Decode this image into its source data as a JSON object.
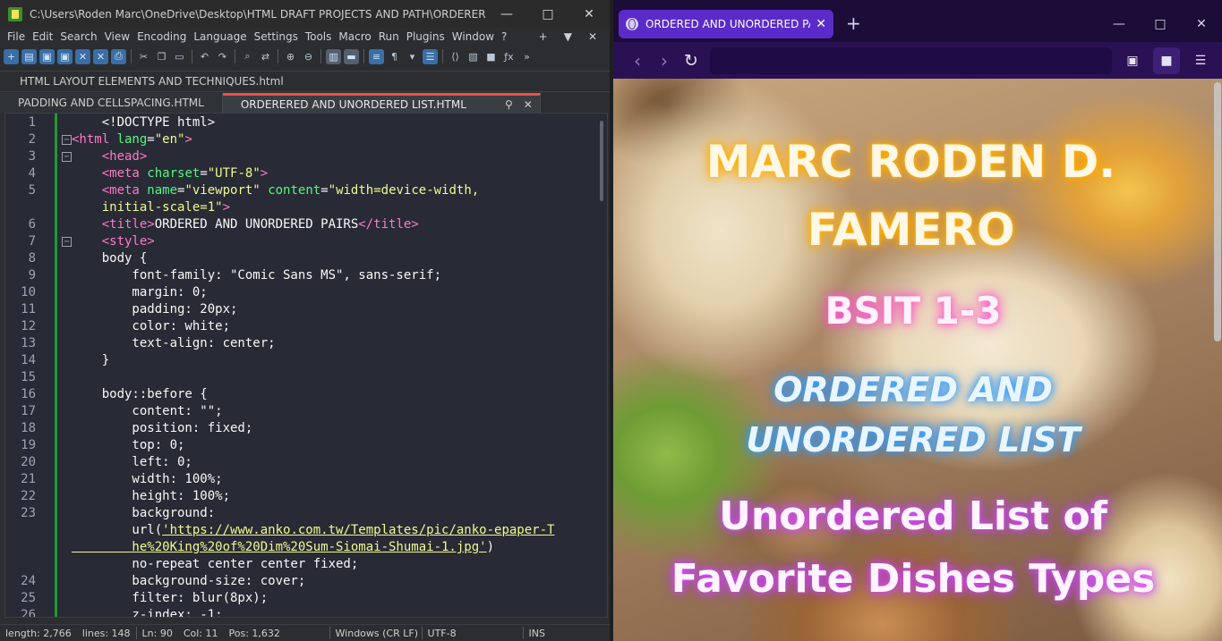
{
  "npp": {
    "title": "C:\\Users\\Roden Marc\\OneDrive\\Desktop\\HTML DRAFT PROJECTS AND PATH\\ORDERERED AND...",
    "menu": [
      "File",
      "Edit",
      "Search",
      "View",
      "Encoding",
      "Language",
      "Settings",
      "Tools",
      "Macro",
      "Run",
      "Plugins",
      "Window",
      "?"
    ],
    "menu_right": [
      "+",
      "▼",
      "✕"
    ],
    "project_tab": "HTML LAYOUT ELEMENTS  AND TECHNIQUES.html",
    "tabs": [
      {
        "label": "PADDING AND CELLSPACING.HTML"
      },
      {
        "label": "ORDERERED AND UNORDERED LIST.HTML"
      }
    ],
    "status": {
      "length": "length: 2,766",
      "lines": "lines: 148",
      "ln": "Ln: 90",
      "col": "Col: 11",
      "pos": "Pos: 1,632",
      "eol": "Windows (CR LF)",
      "encoding": "UTF-8",
      "mode": "INS"
    },
    "code": [
      {
        "n": "1",
        "fold": "",
        "segs": [
          {
            "c": "txt",
            "t": "    <!DOCTYPE html>"
          }
        ]
      },
      {
        "n": "2",
        "fold": "−",
        "segs": [
          {
            "c": "tag",
            "t": "<html "
          },
          {
            "c": "attr",
            "t": "lang"
          },
          {
            "c": "txt",
            "t": "="
          },
          {
            "c": "str",
            "t": "\"en\""
          },
          {
            "c": "tag",
            "t": ">"
          }
        ]
      },
      {
        "n": "3",
        "fold": "−",
        "segs": [
          {
            "c": "tag",
            "t": "    <head>"
          }
        ]
      },
      {
        "n": "4",
        "fold": "",
        "segs": [
          {
            "c": "tag",
            "t": "    <meta "
          },
          {
            "c": "attr",
            "t": "charset"
          },
          {
            "c": "txt",
            "t": "="
          },
          {
            "c": "str",
            "t": "\"UTF-8\""
          },
          {
            "c": "tag",
            "t": ">"
          }
        ]
      },
      {
        "n": "5",
        "fold": "",
        "segs": [
          {
            "c": "tag",
            "t": "    <meta "
          },
          {
            "c": "attr",
            "t": "name"
          },
          {
            "c": "txt",
            "t": "="
          },
          {
            "c": "str",
            "t": "\"viewport\""
          },
          {
            "c": "txt",
            "t": " "
          },
          {
            "c": "attr",
            "t": "content"
          },
          {
            "c": "txt",
            "t": "="
          },
          {
            "c": "str",
            "t": "\"width=device-width,"
          }
        ]
      },
      {
        "n": "",
        "fold": "",
        "segs": [
          {
            "c": "str",
            "t": "    initial-scale=1\""
          },
          {
            "c": "tag",
            "t": ">"
          }
        ]
      },
      {
        "n": "6",
        "fold": "",
        "segs": [
          {
            "c": "tag",
            "t": "    <title>"
          },
          {
            "c": "txt",
            "t": "ORDERED AND UNORDERED PAIRS"
          },
          {
            "c": "tag",
            "t": "</title>"
          }
        ]
      },
      {
        "n": "7",
        "fold": "−",
        "segs": [
          {
            "c": "tag",
            "t": "    <style>"
          }
        ]
      },
      {
        "n": "8",
        "fold": "",
        "segs": [
          {
            "c": "txt",
            "t": "    body {"
          }
        ]
      },
      {
        "n": "9",
        "fold": "",
        "segs": [
          {
            "c": "txt",
            "t": "        font-family: \"Comic Sans MS\", sans-serif;"
          }
        ]
      },
      {
        "n": "10",
        "fold": "",
        "segs": [
          {
            "c": "txt",
            "t": "        margin: 0;"
          }
        ]
      },
      {
        "n": "11",
        "fold": "",
        "segs": [
          {
            "c": "txt",
            "t": "        padding: 20px;"
          }
        ]
      },
      {
        "n": "12",
        "fold": "",
        "segs": [
          {
            "c": "txt",
            "t": "        color: white;"
          }
        ]
      },
      {
        "n": "13",
        "fold": "",
        "segs": [
          {
            "c": "txt",
            "t": "        text-align: center;"
          }
        ]
      },
      {
        "n": "14",
        "fold": "",
        "segs": [
          {
            "c": "txt",
            "t": "    }"
          }
        ]
      },
      {
        "n": "15",
        "fold": "",
        "segs": [
          {
            "c": "txt",
            "t": ""
          }
        ]
      },
      {
        "n": "16",
        "fold": "",
        "segs": [
          {
            "c": "txt",
            "t": "    body::before {"
          }
        ]
      },
      {
        "n": "17",
        "fold": "",
        "segs": [
          {
            "c": "txt",
            "t": "        content: \"\";"
          }
        ]
      },
      {
        "n": "18",
        "fold": "",
        "segs": [
          {
            "c": "txt",
            "t": "        position: fixed;"
          }
        ]
      },
      {
        "n": "19",
        "fold": "",
        "segs": [
          {
            "c": "txt",
            "t": "        top: 0;"
          }
        ]
      },
      {
        "n": "20",
        "fold": "",
        "segs": [
          {
            "c": "txt",
            "t": "        left: 0;"
          }
        ]
      },
      {
        "n": "21",
        "fold": "",
        "segs": [
          {
            "c": "txt",
            "t": "        width: 100%;"
          }
        ]
      },
      {
        "n": "22",
        "fold": "",
        "segs": [
          {
            "c": "txt",
            "t": "        height: 100%;"
          }
        ]
      },
      {
        "n": "23",
        "fold": "",
        "segs": [
          {
            "c": "txt",
            "t": "        background:"
          }
        ]
      },
      {
        "n": "",
        "fold": "",
        "segs": [
          {
            "c": "txt",
            "t": "        url("
          },
          {
            "c": "url",
            "t": "'https://www.anko.com.tw/Templates/pic/anko-epaper-T"
          }
        ]
      },
      {
        "n": "",
        "fold": "",
        "segs": [
          {
            "c": "url",
            "t": "        he%20King%20of%20Dim%20Sum-Siomai-Shumai-1.jpg'"
          },
          {
            "c": "txt",
            "t": ")"
          }
        ]
      },
      {
        "n": "",
        "fold": "",
        "segs": [
          {
            "c": "txt",
            "t": "        no-repeat center center fixed;"
          }
        ]
      },
      {
        "n": "24",
        "fold": "",
        "segs": [
          {
            "c": "txt",
            "t": "        background-size: cover;"
          }
        ]
      },
      {
        "n": "25",
        "fold": "",
        "segs": [
          {
            "c": "txt",
            "t": "        filter: blur(8px);"
          }
        ]
      },
      {
        "n": "26",
        "fold": "",
        "segs": [
          {
            "c": "txt",
            "t": "        z-index: -1;"
          }
        ]
      }
    ]
  },
  "browser": {
    "tab_title": "ORDERED AND UNORDERED PA",
    "new_tab": "+",
    "url": "",
    "page": {
      "name": "MARC RODEN D. FAMERO",
      "class": "BSIT 1-3",
      "subtitle": "ORDERED AND UNORDERED LIST",
      "list_heading": "Unordered List of Favorite Dishes Types"
    }
  }
}
